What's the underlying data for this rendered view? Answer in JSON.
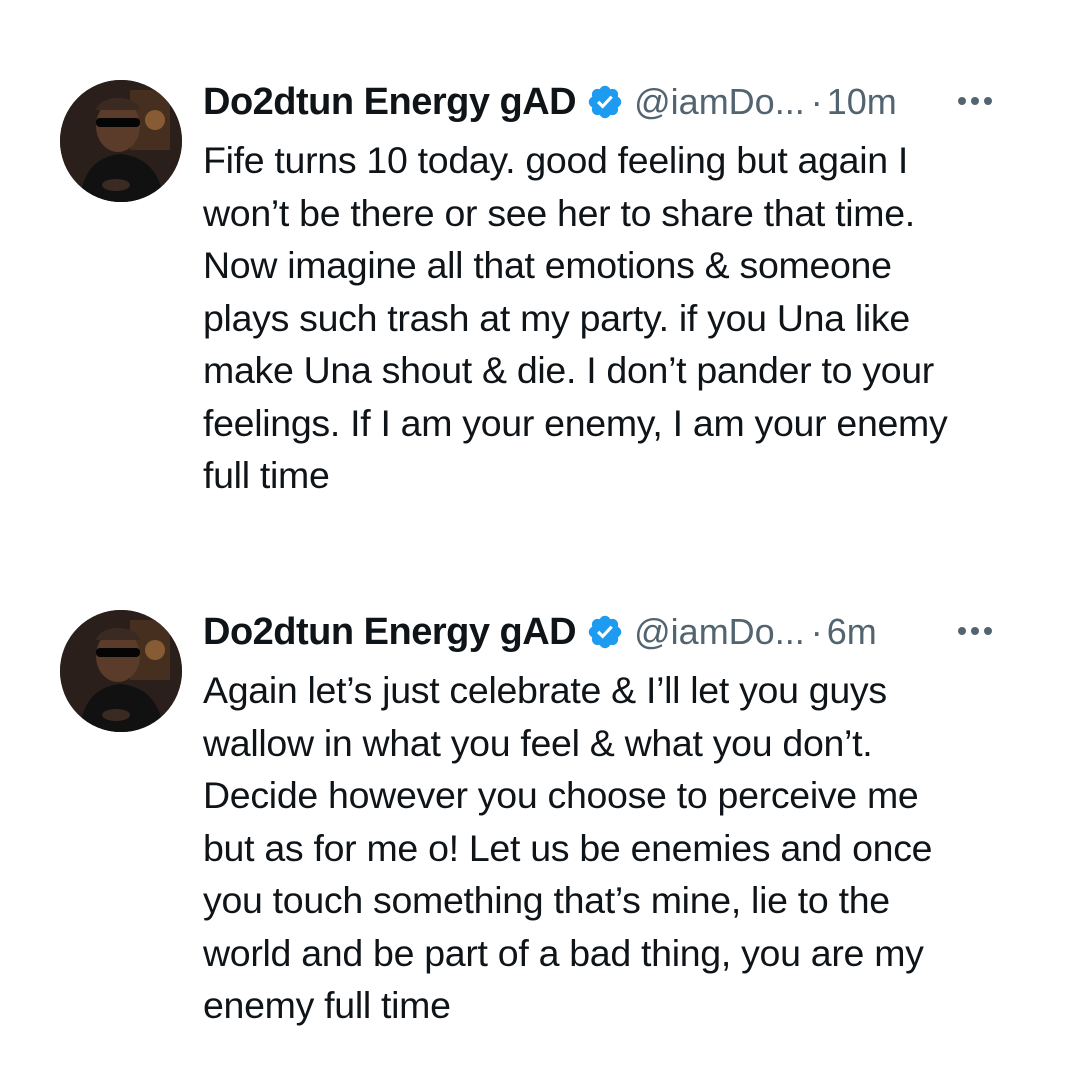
{
  "tweets": [
    {
      "author": {
        "display_name": "Do2dtun Energy gAD",
        "handle": "@iamDo...",
        "verified": true
      },
      "separator": "·",
      "time": "10m",
      "more_icon": "more-horizontal-icon",
      "text_lines": [
        "Fife turns 10 today. good feeling but again I",
        "won’t be there or see her to share that time.",
        "Now imagine all that emotions & someone",
        "plays such trash at my party. if you Una like",
        "make Una shout & die. I don’t pander to your",
        "feelings. If I am your enemy, I am your enemy",
        "full time"
      ]
    },
    {
      "author": {
        "display_name": "Do2dtun Energy gAD",
        "handle": "@iamDo...",
        "verified": true
      },
      "separator": "·",
      "time": "6m",
      "more_icon": "more-horizontal-icon",
      "text_lines": [
        "Again let’s just celebrate & I’ll let you guys",
        "wallow in what you feel & what you don’t.",
        "Decide however you choose to perceive me",
        "but as for me o! Let us be enemies and once",
        "you touch something that’s mine, lie to the",
        "world and be part of a bad thing, you are my",
        "enemy full time"
      ]
    }
  ],
  "colors": {
    "text_primary": "#0f1419",
    "text_secondary": "#536471",
    "verified_blue": "#1d9bf0",
    "background": "#ffffff"
  }
}
